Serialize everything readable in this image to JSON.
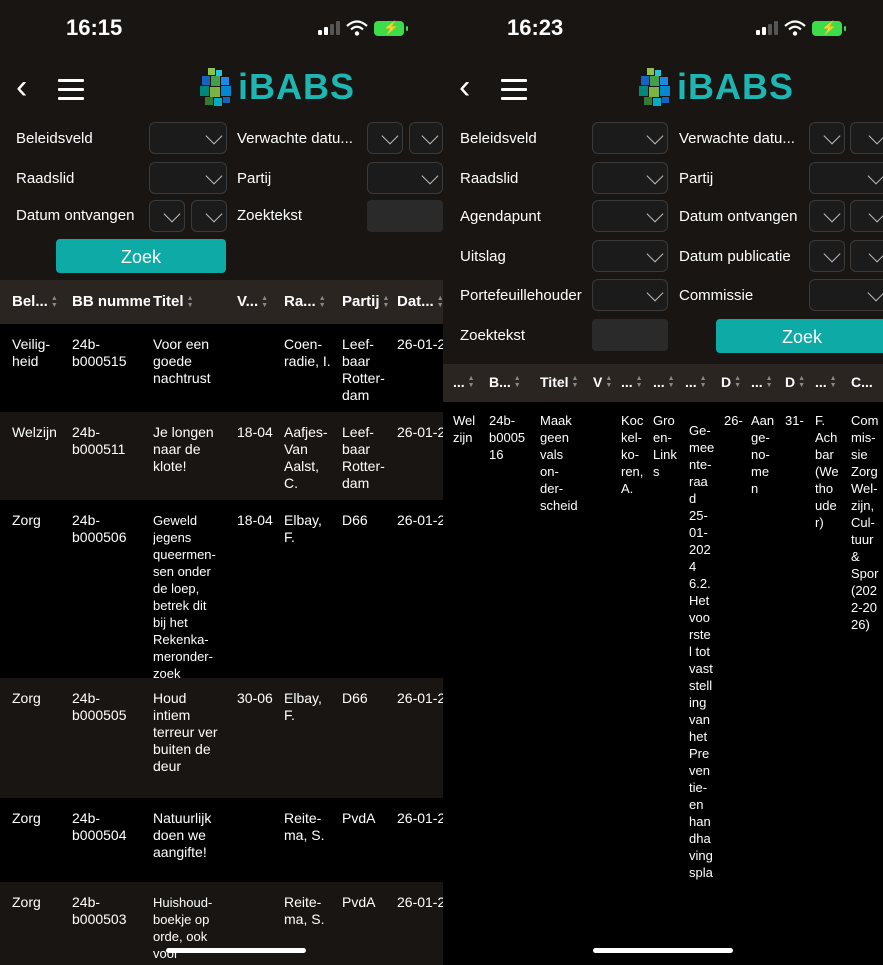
{
  "colors": {
    "accent": "#0eaaa6",
    "logo": "#1eb6b2",
    "header_bg": "#191512",
    "table_head_bg": "#2b2522"
  },
  "left": {
    "status": {
      "time": "16:15"
    },
    "logo": "iBABS",
    "filters": {
      "beleidsveld": "Beleidsveld",
      "verwachte": "Verwachte datu...",
      "raadslid": "Raadslid",
      "partij": "Partij",
      "datum_ontvangen": "Datum ontvangen",
      "zoektekst": "Zoektekst",
      "zoek": "Zoek"
    },
    "columns": [
      "Bel...",
      "BB nummer",
      "Titel",
      "V...",
      "Ra...",
      "Partij",
      "Dat..."
    ],
    "rows": [
      {
        "beleidsveld": "Veilig-\nheid",
        "nummer": "24b-\nb000515",
        "titel": "Voor een\ngoede\nnachtrust",
        "v": "",
        "raadslid": "Coen-\nradie, I.",
        "partij": "Leef-\nbaar\nRotter-\ndam",
        "datum": "26-01-2"
      },
      {
        "beleidsveld": "Welzijn",
        "nummer": "24b-\nb000511",
        "titel": "Je longen\nnaar de\nklote!",
        "v": "18-04",
        "raadslid": "Aafjes-\nVan\nAalst,\nC.",
        "partij": "Leef-\nbaar\nRotter-\ndam",
        "datum": "26-01-2"
      },
      {
        "beleidsveld": "Zorg",
        "nummer": "24b-\nb000506",
        "titel": "Geweld\njegens\nqueermen-\nsen onder\nde loep,\nbetrek dit\nbij het\nRekenka-\nmeronder-\nzoek",
        "v": "18-04",
        "raadslid": "Elbay,\nF.",
        "partij": "D66",
        "datum": "26-01-2"
      },
      {
        "beleidsveld": "Zorg",
        "nummer": "24b-\nb000505",
        "titel": "Houd\nintiem\nterreur ver\nbuiten de\ndeur",
        "v": "30-06",
        "raadslid": "Elbay,\nF.",
        "partij": "D66",
        "datum": "26-01-2"
      },
      {
        "beleidsveld": "Zorg",
        "nummer": "24b-\nb000504",
        "titel": "Natuurlijk\ndoen we\naangifte!",
        "v": "",
        "raadslid": "Reite-\nma, S.",
        "partij": "PvdA",
        "datum": "26-01-2"
      },
      {
        "beleidsveld": "Zorg",
        "nummer": "24b-\nb000503",
        "titel": "Huishoud-\nboekje op\norde, ook\nvoor\nbeleidsplan",
        "v": "",
        "raadslid": "Reite-\nma, S.",
        "partij": "PvdA",
        "datum": "26-01-2"
      }
    ]
  },
  "right": {
    "status": {
      "time": "16:23"
    },
    "logo": "iBABS",
    "filters": {
      "beleidsveld": "Beleidsveld",
      "verwachte": "Verwachte datu...",
      "raadslid": "Raadslid",
      "partij": "Partij",
      "agendapunt": "Agendapunt",
      "datum_ontvangen": "Datum ontvangen",
      "uitslag": "Uitslag",
      "datum_publicatie": "Datum publicatie",
      "portefeuillehouder": "Portefeuillehouder",
      "commissie": "Commissie",
      "zoektekst": "Zoektekst",
      "zoek": "Zoek"
    },
    "columns": [
      "...",
      "B...",
      "Titel",
      "V",
      "...",
      "...",
      "...",
      "D",
      "...",
      "D",
      "...",
      "C..."
    ],
    "row": {
      "c1": "Wel\nzijn",
      "c2": "24b-\nb0005\n16",
      "c3": "Maak\ngeen\nvals\non-\nder-\nscheid",
      "c5": "Koc\nkel-\nko-\nren,\nA.",
      "c6": "Gro\nen-\nLink\ns",
      "c7": "Ge-\nmee\nnte-\nraa\nd\n25-\n01-\n202\n4\n6.2.\nHet\nvoo\nrste\nl tot\nvast\nstell\ning\nvan\nhet\nPre\nven\ntie-\nen\nhan\ndha\nving\nspla",
      "c8": "26-",
      "c9": "Aan\nge-\nno-\nme\nn",
      "c10": "31-",
      "c11": "F.\nAch\nbar\n(We\ntho\nude\nr)",
      "c12": "Com\nmis-\nsie\nZorg\nWel-\nzijn,\nCul-\ntuur\n&\nSpor\n(202\n2-20\n26)"
    }
  }
}
